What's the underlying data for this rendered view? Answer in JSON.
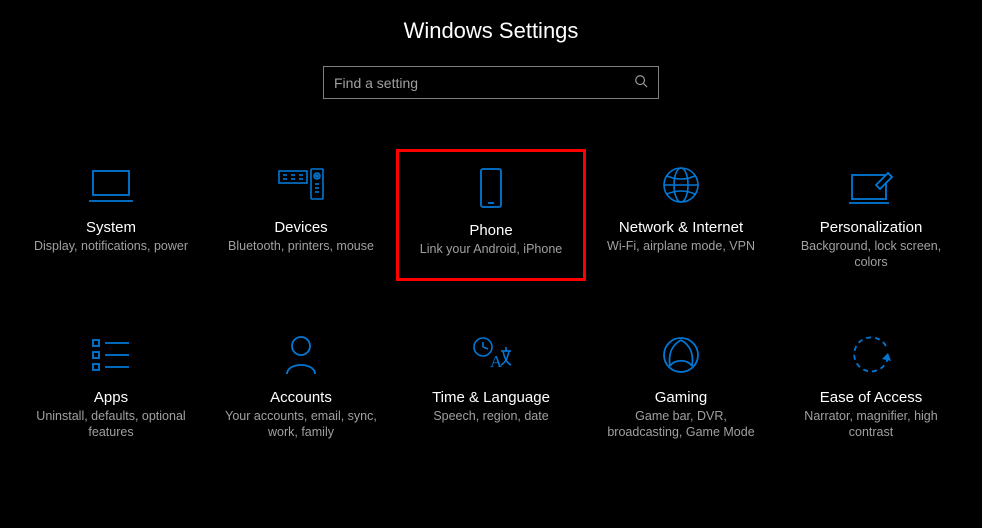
{
  "header": {
    "title": "Windows Settings"
  },
  "search": {
    "placeholder": "Find a setting"
  },
  "accent": "#0078d7",
  "tiles": {
    "system": {
      "title": "System",
      "desc": "Display, notifications, power"
    },
    "devices": {
      "title": "Devices",
      "desc": "Bluetooth, printers, mouse"
    },
    "phone": {
      "title": "Phone",
      "desc": "Link your Android, iPhone"
    },
    "network": {
      "title": "Network & Internet",
      "desc": "Wi-Fi, airplane mode, VPN"
    },
    "personalization": {
      "title": "Personalization",
      "desc": "Background, lock screen, colors"
    },
    "apps": {
      "title": "Apps",
      "desc": "Uninstall, defaults, optional features"
    },
    "accounts": {
      "title": "Accounts",
      "desc": "Your accounts, email, sync, work, family"
    },
    "time": {
      "title": "Time & Language",
      "desc": "Speech, region, date"
    },
    "gaming": {
      "title": "Gaming",
      "desc": "Game bar, DVR, broadcasting, Game Mode"
    },
    "ease": {
      "title": "Ease of Access",
      "desc": "Narrator, magnifier, high contrast"
    }
  }
}
